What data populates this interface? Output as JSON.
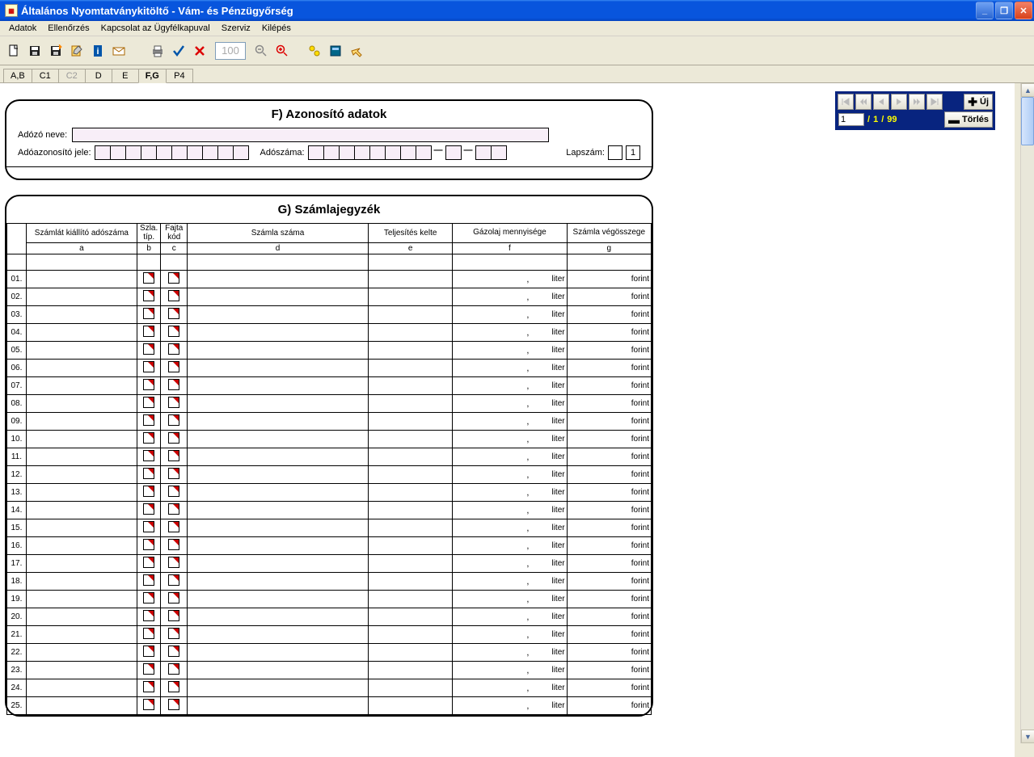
{
  "window": {
    "title": "Általános Nyomtatványkitöltő - Vám- és Pénzügyőrség"
  },
  "menu": {
    "items": [
      "Adatok",
      "Ellenőrzés",
      "Kapcsolat az Ügyfélkapuval",
      "Szerviz",
      "Kilépés"
    ]
  },
  "toolbar": {
    "zoom": "100"
  },
  "tabs": [
    {
      "label": "A,B",
      "active": false,
      "disabled": false
    },
    {
      "label": "C1",
      "active": false,
      "disabled": false
    },
    {
      "label": "C2",
      "active": false,
      "disabled": true
    },
    {
      "label": "D",
      "active": false,
      "disabled": false
    },
    {
      "label": "E",
      "active": false,
      "disabled": false
    },
    {
      "label": "F,G",
      "active": true,
      "disabled": false
    },
    {
      "label": "P4",
      "active": false,
      "disabled": false
    }
  ],
  "sectionF": {
    "title": "F) Azonosító adatok",
    "labels": {
      "name": "Adózó neve:",
      "taxId": "Adóazonosító jele:",
      "taxNum": "Adószáma:",
      "pageNum": "Lapszám:"
    },
    "pageValue": "1",
    "taxIdBoxCount": 10,
    "taxNumGroups": [
      8,
      1,
      2
    ]
  },
  "sectionG": {
    "title": "G) Számlajegyzék",
    "headers": {
      "a": "Számlát kiállító adószáma",
      "b": "Szla. típ.",
      "c": "Fajta kód",
      "d": "Számla száma",
      "e": "Teljesítés kelte",
      "f": "Gázolaj mennyisége",
      "g": "Számla végösszege"
    },
    "subheaders": {
      "a": "a",
      "b": "b",
      "c": "c",
      "d": "d",
      "e": "e",
      "f": "f",
      "g": "g"
    },
    "unitF": "liter",
    "unitG": "forint",
    "rowCount": 25
  },
  "nav": {
    "uj": "Új",
    "torles": "Törlés",
    "current": "1",
    "page": "1",
    "total": "99"
  }
}
